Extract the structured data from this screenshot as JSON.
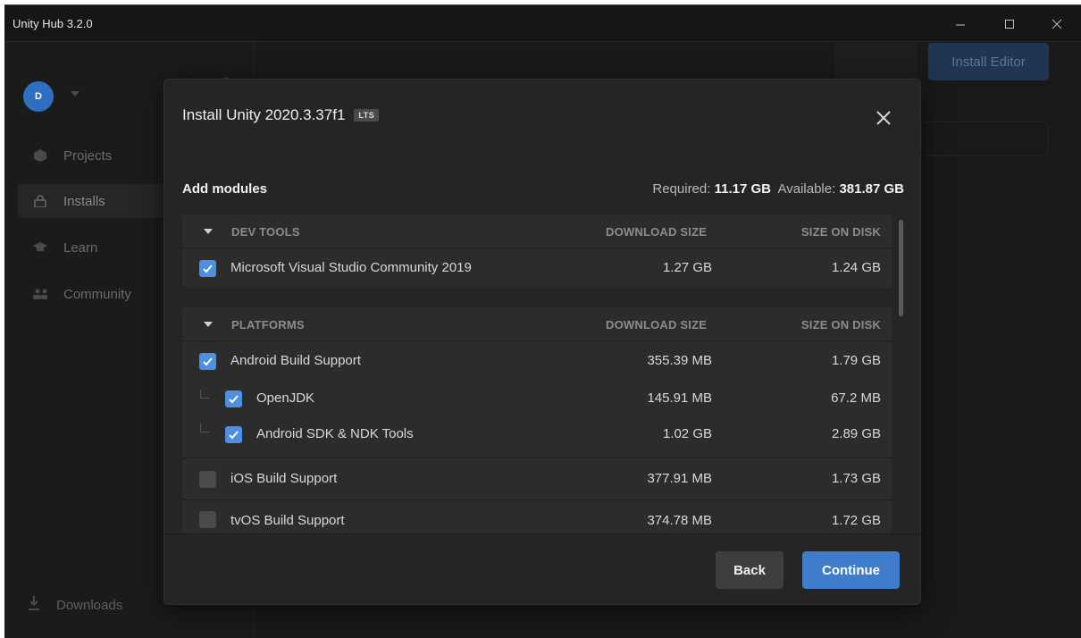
{
  "window": {
    "title": "Unity Hub 3.2.0"
  },
  "sidebar": {
    "avatar_initial": "D",
    "items": [
      {
        "label": "Projects",
        "icon": "cube-icon"
      },
      {
        "label": "Installs",
        "icon": "lock-icon"
      },
      {
        "label": "Learn",
        "icon": "graduation-cap-icon"
      },
      {
        "label": "Community",
        "icon": "people-icon"
      }
    ],
    "downloads_label": "Downloads"
  },
  "main": {
    "install_editor_label": "Install Editor"
  },
  "dialog": {
    "title": "Install Unity 2020.3.37f1",
    "badge": "LTS",
    "section_label": "Add modules",
    "required_label": "Required:",
    "required_value": "11.17 GB",
    "available_label": "Available:",
    "available_value": "381.87 GB",
    "groups": [
      {
        "name": "DEV TOOLS",
        "col_download": "DOWNLOAD SIZE",
        "col_disk": "SIZE ON DISK",
        "rows": [
          {
            "label": "Microsoft Visual Studio Community 2019",
            "download": "1.27 GB",
            "disk": "1.24 GB",
            "checked": true,
            "child": false
          }
        ]
      },
      {
        "name": "PLATFORMS",
        "col_download": "DOWNLOAD SIZE",
        "col_disk": "SIZE ON DISK",
        "rows": [
          {
            "label": "Android Build Support",
            "download": "355.39 MB",
            "disk": "1.79 GB",
            "checked": true,
            "child": false
          },
          {
            "label": "OpenJDK",
            "download": "145.91 MB",
            "disk": "67.2 MB",
            "checked": true,
            "child": true
          },
          {
            "label": "Android SDK & NDK Tools",
            "download": "1.02 GB",
            "disk": "2.89 GB",
            "checked": true,
            "child": true
          },
          {
            "label": "iOS Build Support",
            "download": "377.91 MB",
            "disk": "1.73 GB",
            "checked": false,
            "child": false
          },
          {
            "label": "tvOS Build Support",
            "download": "374.78 MB",
            "disk": "1.72 GB",
            "checked": false,
            "child": false
          }
        ]
      }
    ],
    "back_label": "Back",
    "continue_label": "Continue"
  },
  "colors": {
    "accent": "#3f7ccc",
    "checkbox_on": "#4d8fe0",
    "dialog_bg": "#252525",
    "window_bg": "#191919"
  }
}
